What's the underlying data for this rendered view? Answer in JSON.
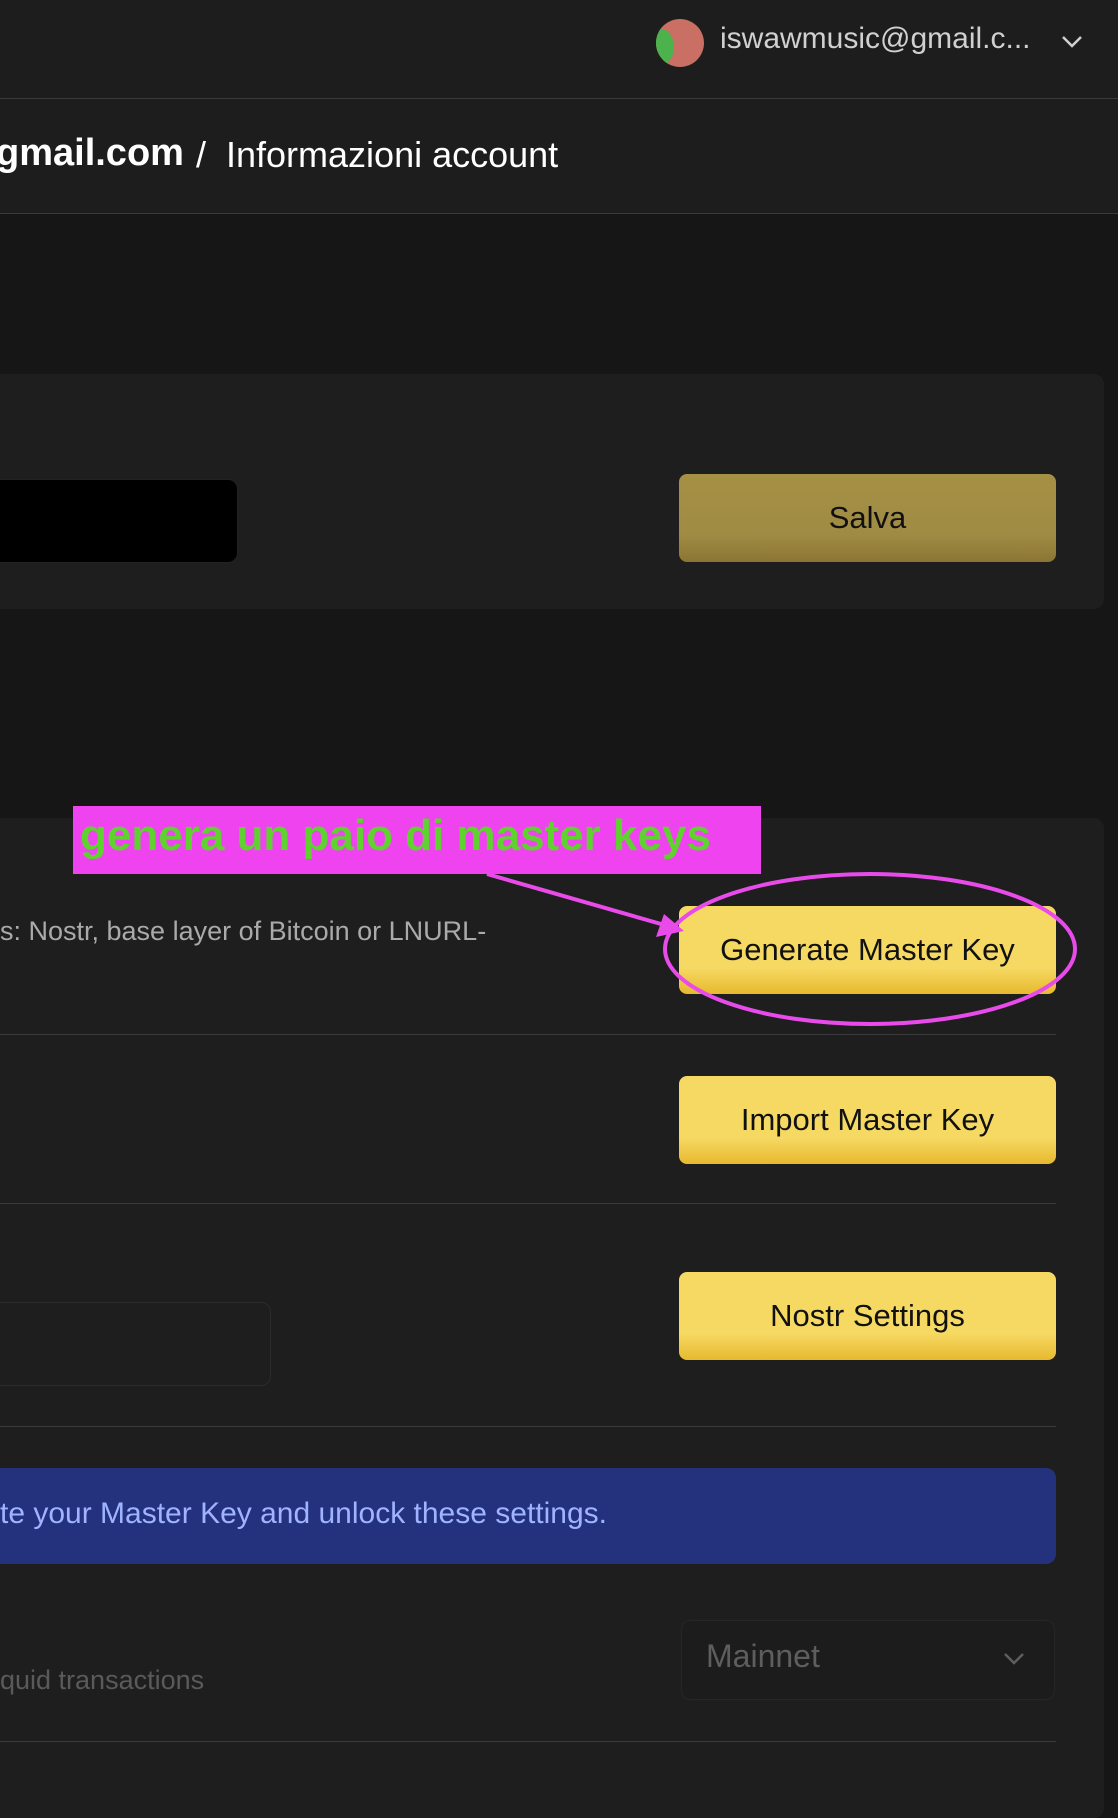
{
  "header": {
    "user_email": "iswawmusic@gmail.c...",
    "icons": {
      "avatar": "avatar",
      "dropdown": "chevron-down-icon"
    }
  },
  "breadcrumb": {
    "account": "gmail.com",
    "separator": "/",
    "current_page": "Informazioni account"
  },
  "profile": {
    "save_label": "Salva"
  },
  "keys": {
    "description": "s: Nostr, base layer of Bitcoin or LNURL-",
    "generate_label": "Generate Master Key",
    "import_label": "Import Master Key",
    "nostr_settings_label": "Nostr Settings"
  },
  "info": {
    "banner_text": "te your Master Key and unlock these settings."
  },
  "network": {
    "description": "quid transactions",
    "selected": "Mainnet"
  },
  "annotation": {
    "text": "genera un paio di master keys",
    "colors": {
      "highlight": "#ef43f0",
      "text": "#5fd22f"
    }
  },
  "colors": {
    "background": "#161616",
    "panel": "#1e1e1e",
    "accent_button": "#f6d963",
    "banner": "#24317c",
    "banner_text": "#9fb3ff"
  }
}
